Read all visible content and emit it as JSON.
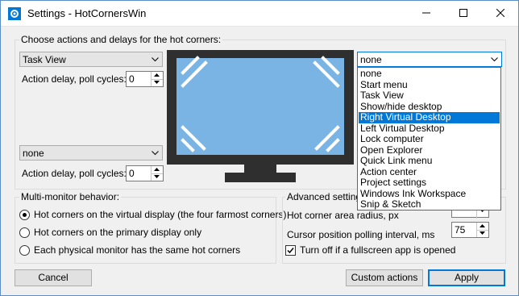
{
  "window": {
    "title": "Settings - HotCornersWin"
  },
  "titlebar": {
    "app_icon": "settings-gear-icon",
    "minimize_icon": "minimize-icon",
    "maximize_icon": "maximize-icon",
    "close_icon": "close-icon"
  },
  "corners": {
    "heading": "Choose actions and delays for the hot corners:",
    "top_left": {
      "action": "Task View",
      "delay_label": "Action delay, poll cycles:",
      "delay": "0"
    },
    "bottom_left": {
      "action": "none",
      "delay_label": "Action delay, poll cycles:",
      "delay": "0"
    },
    "top_right": {
      "action": "none"
    }
  },
  "dropdown": {
    "selected_index": 4,
    "options": [
      "none",
      "Start menu",
      "Task View",
      "Show/hide desktop",
      "Right Virtual Desktop",
      "Left Virtual Desktop",
      "Lock computer",
      "Open Explorer",
      "Quick Link menu",
      "Action center",
      "Project settings",
      "Windows Ink Workspace",
      "Snip & Sketch"
    ]
  },
  "monitor": {
    "screen_color": "#7ab4e4",
    "frame_color": "#2f2f2f"
  },
  "multi_monitor": {
    "title": "Multi-monitor behavior:",
    "options": [
      {
        "label": "Hot corners on the virtual display (the four farmost corners)",
        "checked": true
      },
      {
        "label": "Hot corners on the primary display only",
        "checked": false
      },
      {
        "label": "Each physical monitor has the same hot corners",
        "checked": false
      }
    ]
  },
  "advanced": {
    "title": "Advanced settings",
    "radius_label": "Hot corner area radius, px",
    "poll_label": "Cursor position polling interval, ms",
    "poll_value": "75",
    "fullscreen_label": "Turn off if a fullscreen app is opened",
    "fullscreen_checked": true
  },
  "buttons": {
    "cancel": "Cancel",
    "custom_actions": "Custom actions",
    "apply": "Apply"
  }
}
